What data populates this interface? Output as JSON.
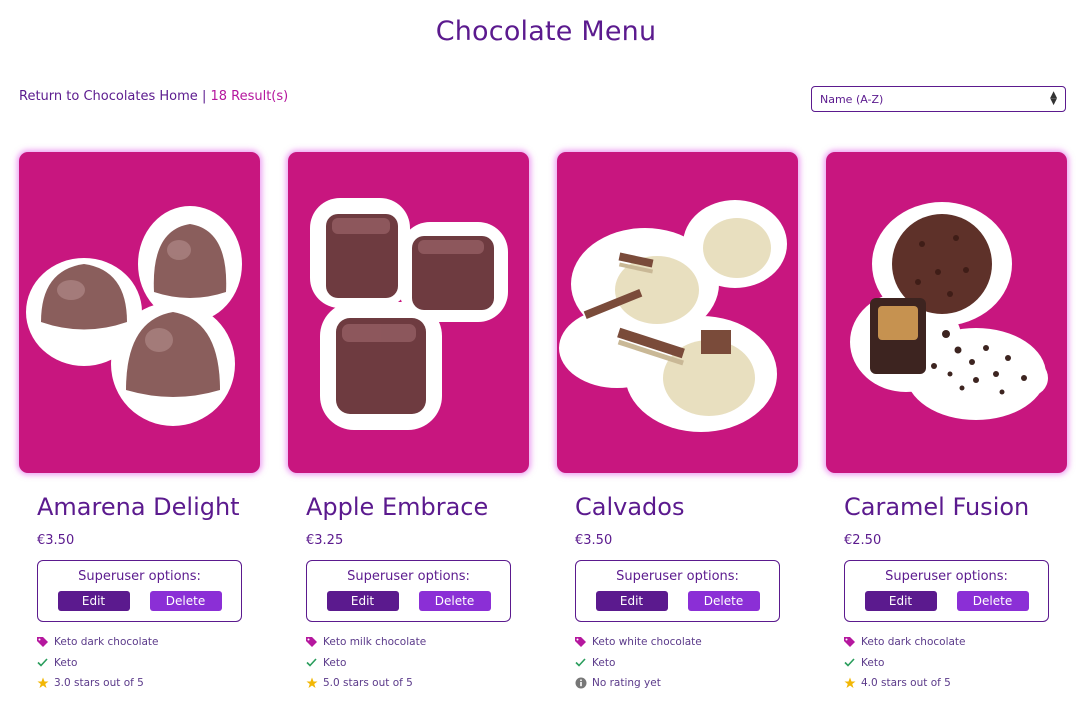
{
  "page": {
    "title": "Chocolate Menu"
  },
  "topbar": {
    "home_link": "Return to Chocolates Home",
    "separator": "|",
    "result_count": "18 Result(s)"
  },
  "sort": {
    "selected": "Name (A-Z)"
  },
  "colors": {
    "brand_purple": "#5b1a8e",
    "card_magenta": "#c8167f",
    "delete_purple": "#8b2fd6",
    "tag_pink": "#b5179e",
    "check_green": "#2a9d5c",
    "star_gold": "#f2b705"
  },
  "superuser": {
    "title": "Superuser options:",
    "edit_label": "Edit",
    "delete_label": "Delete"
  },
  "products": [
    {
      "name": "Amarena Delight",
      "price": "€3.50",
      "category": "Keto dark chocolate",
      "diet": "Keto",
      "rating": "3.0 stars out of 5",
      "rating_icon": "star-icon"
    },
    {
      "name": "Apple Embrace",
      "price": "€3.25",
      "category": "Keto milk chocolate",
      "diet": "Keto",
      "rating": "5.0 stars out of 5",
      "rating_icon": "star-icon"
    },
    {
      "name": "Calvados",
      "price": "€3.50",
      "category": "Keto white chocolate",
      "diet": "Keto",
      "rating": "No rating yet",
      "rating_icon": "info-icon"
    },
    {
      "name": "Caramel Fusion",
      "price": "€2.50",
      "category": "Keto dark chocolate",
      "diet": "Keto",
      "rating": "4.0 stars out of 5",
      "rating_icon": "star-icon"
    }
  ]
}
